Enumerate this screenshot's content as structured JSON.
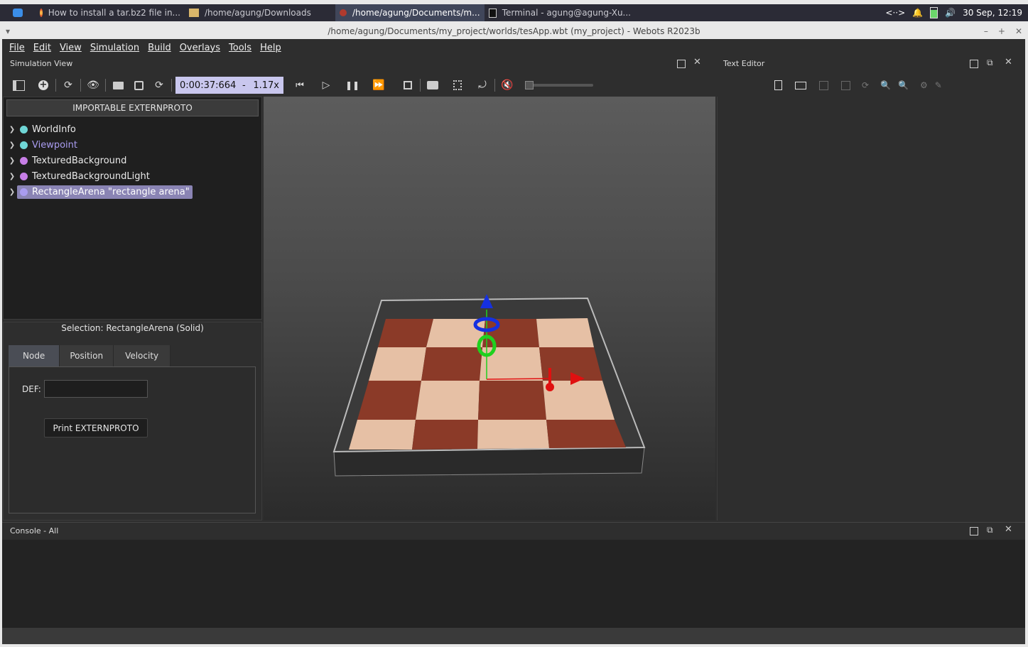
{
  "taskbar": {
    "tasks": [
      {
        "label": "How to install a tar.bz2 file in..."
      },
      {
        "label": "/home/agung/Downloads"
      },
      {
        "label": "/home/agung/Documents/m..."
      },
      {
        "label": "Terminal - agung@agung-Xu..."
      }
    ],
    "tray": {
      "network": "<··>",
      "clock": "30 Sep, 12:19"
    }
  },
  "window": {
    "title": "/home/agung/Documents/my_project/worlds/tesApp.wbt (my_project) - Webots R2023b"
  },
  "menubar": [
    "File",
    "Edit",
    "View",
    "Simulation",
    "Build",
    "Overlays",
    "Tools",
    "Help"
  ],
  "simulation_view": {
    "title": "Simulation View",
    "time": "0:00:37:664",
    "separator": "-",
    "speed": "1.17x"
  },
  "text_editor": {
    "title": "Text Editor"
  },
  "scene_tree": {
    "importable_button": "IMPORTABLE EXTERNPROTO",
    "nodes": [
      {
        "label": "WorldInfo",
        "color": "#6fd6d6"
      },
      {
        "label": "Viewpoint",
        "color": "#6fd6d6",
        "text_color": "#a99cf0"
      },
      {
        "label": "TexturedBackground",
        "color": "#c77ee6"
      },
      {
        "label": "TexturedBackgroundLight",
        "color": "#c77ee6"
      },
      {
        "label": "RectangleArena \"rectangle arena\"",
        "color": "#a99cf0",
        "selected": true
      }
    ]
  },
  "selection": {
    "label": "Selection: RectangleArena (Solid)",
    "tabs": [
      "Node",
      "Position",
      "Velocity"
    ],
    "def_label": "DEF:",
    "def_value": "",
    "print_button": "Print EXTERNPROTO"
  },
  "console": {
    "title": "Console - All"
  }
}
